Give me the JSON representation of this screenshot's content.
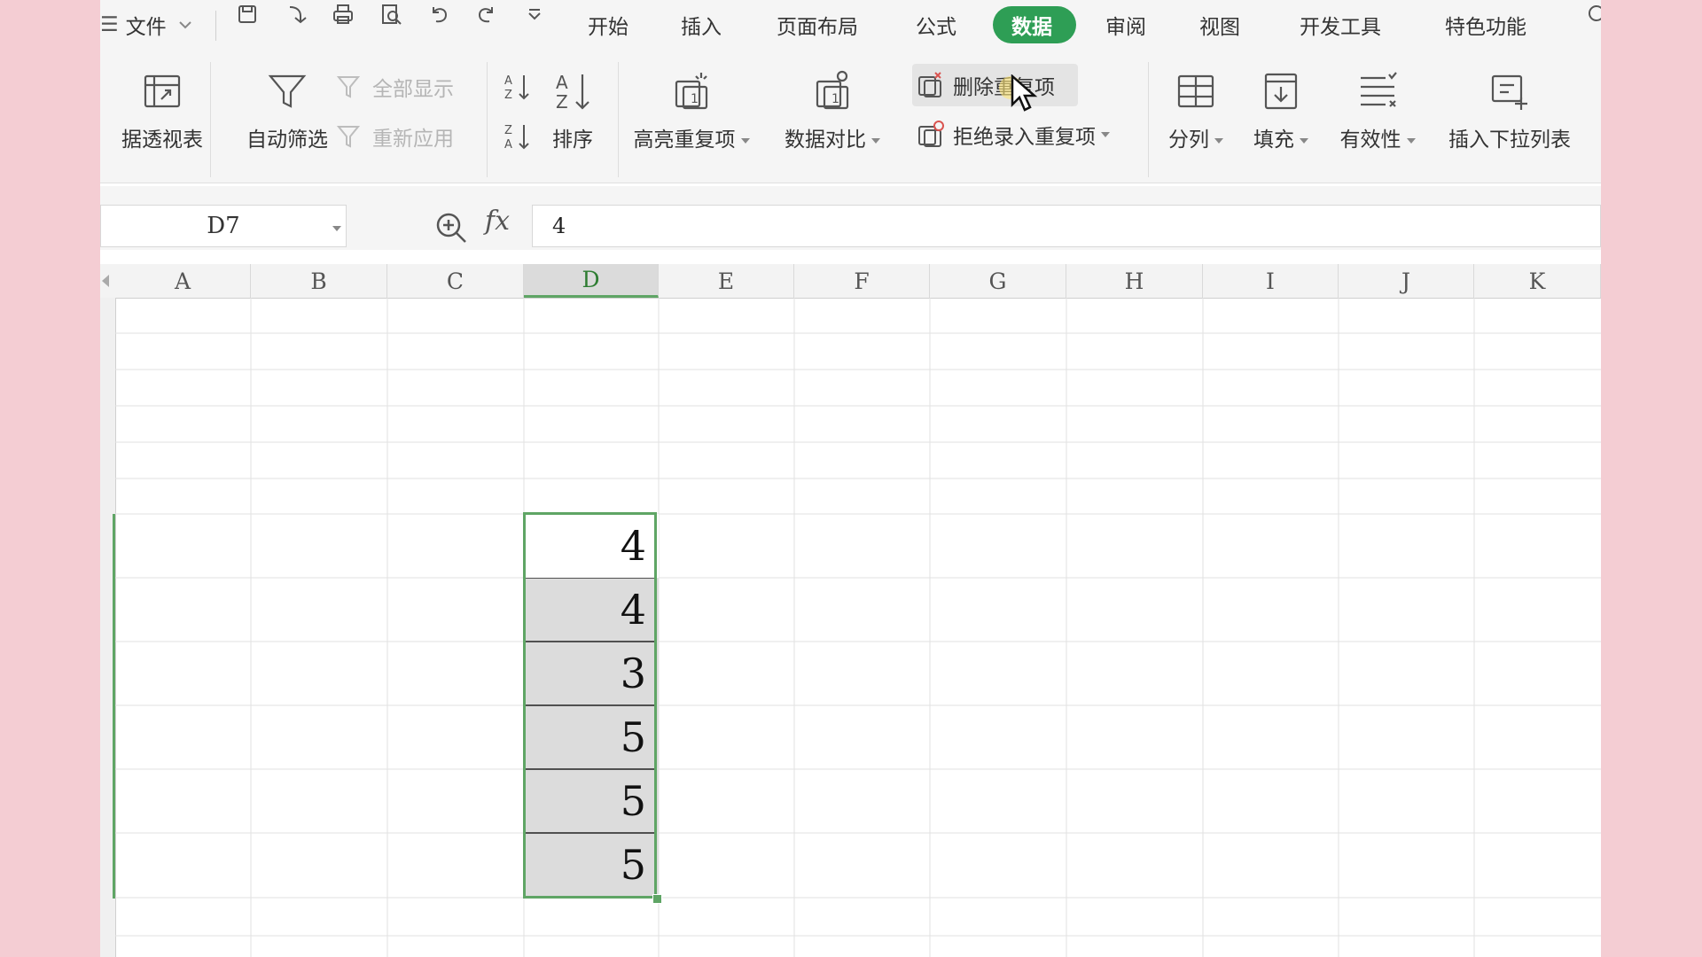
{
  "menu": {
    "file_label": "文件",
    "tabs": [
      "开始",
      "插入",
      "页面布局",
      "公式",
      "数据",
      "审阅",
      "视图",
      "开发工具",
      "特色功能"
    ],
    "active_tab": "数据"
  },
  "ribbon": {
    "pivot_label": "据透视表",
    "autofilter_label": "自动筛选",
    "show_all_label": "全部显示",
    "reapply_label": "重新应用",
    "sort_label": "排序",
    "highlight_dup_label": "高亮重复项",
    "compare_label": "数据对比",
    "remove_dup_label": "删除重复项",
    "reject_dup_label": "拒绝录入重复项",
    "split_label": "分列",
    "fill_label": "填充",
    "validity_label": "有效性",
    "dropdown_label": "插入下拉列表"
  },
  "formula_bar": {
    "name_box": "D7",
    "fx_label": "fx",
    "formula": "4"
  },
  "sheet": {
    "columns": [
      "A",
      "B",
      "C",
      "D",
      "E",
      "F",
      "G",
      "H",
      "I",
      "J",
      "K"
    ],
    "active_column": "D",
    "selected_range_values": [
      "4",
      "4",
      "3",
      "5",
      "5",
      "5"
    ]
  },
  "colors": {
    "accent": "#2e9e55",
    "selection": "#5fa565",
    "background": "#f4cdd3"
  }
}
